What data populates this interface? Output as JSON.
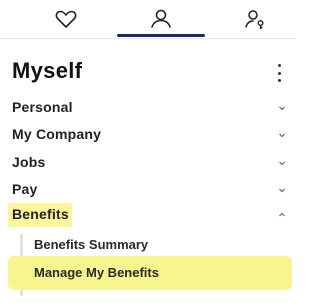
{
  "tabs": [
    {
      "name": "favorites",
      "icon": "heart-icon"
    },
    {
      "name": "myself",
      "icon": "person-icon",
      "active": true
    },
    {
      "name": "people",
      "icon": "person-key-icon"
    }
  ],
  "header": {
    "title": "Myself"
  },
  "menu": {
    "items": [
      {
        "label": "Personal"
      },
      {
        "label": "My Company"
      },
      {
        "label": "Jobs"
      },
      {
        "label": "Pay"
      },
      {
        "label": "Benefits",
        "expanded": true
      }
    ],
    "benefits_subitems": [
      {
        "label": "Benefits Summary"
      },
      {
        "label": "Manage My Benefits"
      }
    ]
  },
  "colors": {
    "accent": "#1a2a6c",
    "highlight": "#fbf79a"
  }
}
